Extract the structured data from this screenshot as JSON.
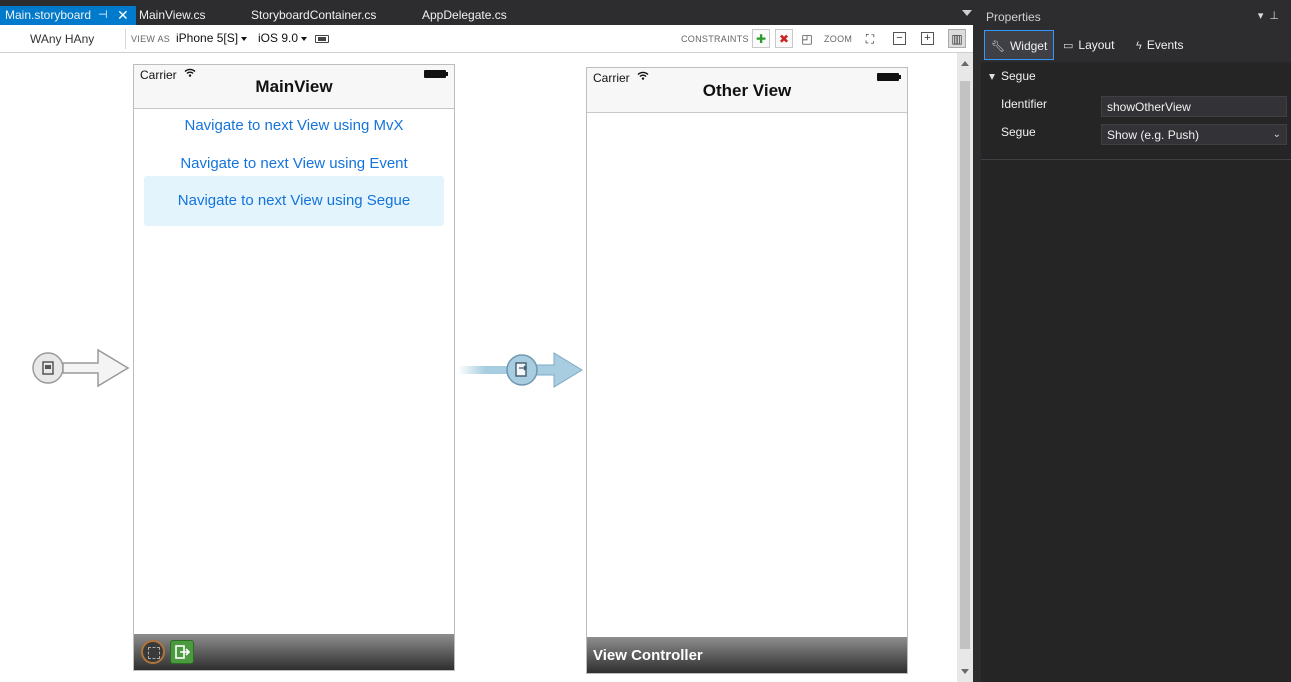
{
  "tabs": [
    {
      "label": "Main.storyboard",
      "active": true
    },
    {
      "label": "MainView.cs"
    },
    {
      "label": "StoryboardContainer.cs"
    },
    {
      "label": "AppDelegate.cs"
    }
  ],
  "toolbar": {
    "size_class": "WAny HAny",
    "view_as_label": "VIEW AS",
    "device": "iPhone 5[S]",
    "ios_version": "iOS 9.0",
    "constraints_label": "CONSTRAINTS",
    "zoom_label": "ZOOM"
  },
  "main_scene": {
    "carrier": "Carrier",
    "title": "MainView",
    "links": [
      "Navigate to next View using MvX",
      "Navigate to next View using Event",
      "Navigate to next View using Segue"
    ]
  },
  "other_scene": {
    "carrier": "Carrier",
    "title": "Other View",
    "footer": "View Controller"
  },
  "properties": {
    "title": "Properties",
    "tabs": [
      "Widget",
      "Layout",
      "Events"
    ],
    "group": "Segue",
    "identifier_label": "Identifier",
    "identifier_value": "showOtherView",
    "segue_label": "Segue",
    "segue_value": "Show (e.g. Push)"
  },
  "colors": {
    "accent": "#007acc",
    "link": "#1474dc",
    "segue_arrow": "#a9cde0"
  }
}
